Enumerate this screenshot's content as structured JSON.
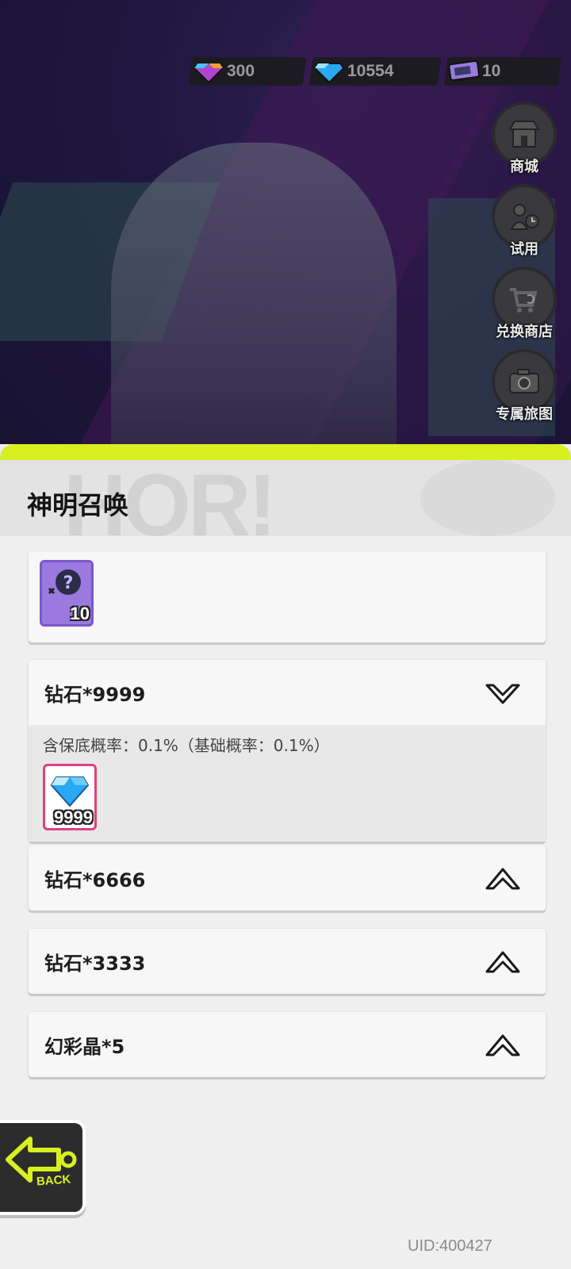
{
  "currencies": [
    {
      "icon": "rainbow-crystal-icon",
      "value": "300"
    },
    {
      "icon": "diamond-icon",
      "value": "10554"
    },
    {
      "icon": "ticket-icon",
      "value": "10"
    }
  ],
  "side_buttons": [
    {
      "icon": "shop-icon",
      "label": "商城"
    },
    {
      "icon": "trial-icon",
      "label": "试用"
    },
    {
      "icon": "exchange-cart-icon",
      "label": "兑换商店"
    },
    {
      "icon": "camera-icon",
      "label": "专属旅图"
    }
  ],
  "panel": {
    "title": "神明召唤",
    "header_art_text": "HOR!"
  },
  "cards": [
    {
      "name": "",
      "item_icon": "ticket-icon",
      "item_count": "10"
    },
    {
      "name": "钻石*9999",
      "rate": "含保底概率：0.1%（基础概率：0.1%）",
      "item_icon": "diamond-icon",
      "item_count": "9999",
      "expanded": true
    },
    {
      "name": "钻石*6666",
      "expanded": false
    },
    {
      "name": "钻石*3333",
      "expanded": false
    },
    {
      "name": "幻彩晶*5",
      "expanded": false
    }
  ],
  "footer": {
    "back_label": "BACK",
    "uid": "UID:400427"
  },
  "colors": {
    "accent": "#d8f020",
    "diamond": "#2aa8f2",
    "ticket": "#9b7ae0",
    "diamond_frame": "#e0407e"
  }
}
